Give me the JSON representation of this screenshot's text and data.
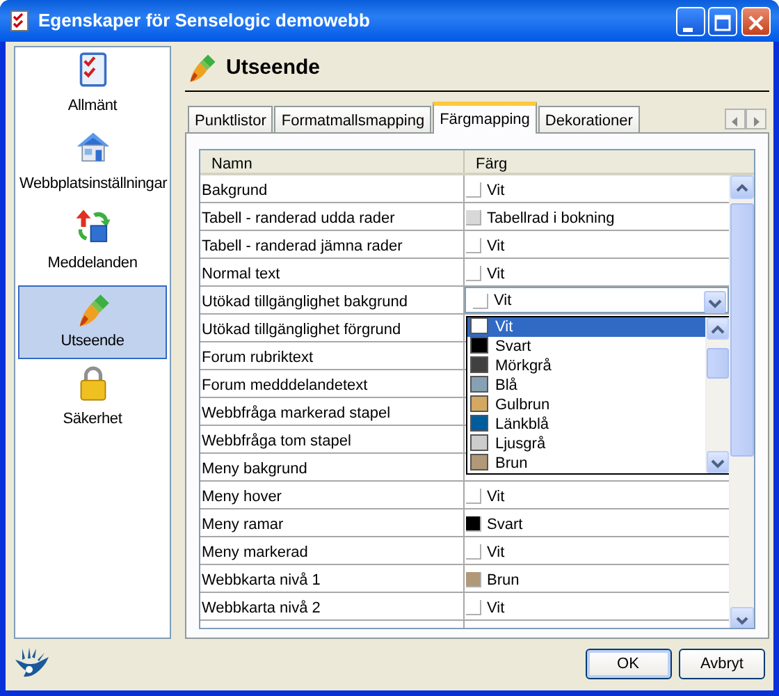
{
  "window": {
    "title": "Egenskaper för Senselogic demowebb"
  },
  "sidebar": {
    "items": [
      {
        "label": "Allmänt",
        "selected": false
      },
      {
        "label": "Webbplatsinställningar",
        "selected": false
      },
      {
        "label": "Meddelanden",
        "selected": false
      },
      {
        "label": "Utseende",
        "selected": true
      },
      {
        "label": "Säkerhet",
        "selected": false
      }
    ]
  },
  "page": {
    "title": "Utseende"
  },
  "tabs": [
    {
      "label": "Punktlistor",
      "selected": false
    },
    {
      "label": "Formatmallsmapping",
      "selected": false
    },
    {
      "label": "Färgmapping",
      "selected": true
    },
    {
      "label": "Dekorationer",
      "selected": false
    }
  ],
  "table": {
    "columns": [
      "Namn",
      "Färg"
    ],
    "rows": [
      {
        "name": "Bakgrund",
        "value": "Vit",
        "color": "#ffffff"
      },
      {
        "name": "Tabell - randerad udda rader",
        "value": "Tabellrad i bokning",
        "color": "#d8d8d8"
      },
      {
        "name": "Tabell - randerad jämna rader",
        "value": "Vit",
        "color": "#ffffff"
      },
      {
        "name": "Normal text",
        "value": "Vit",
        "color": "#ffffff"
      },
      {
        "name": "Utökad tillgänglighet bakgrund",
        "value": "Vit",
        "color": "#ffffff",
        "editing": true,
        "options": [
          {
            "label": "Vit",
            "color": "#ffffff",
            "selected": true
          },
          {
            "label": "Svart",
            "color": "#000000",
            "selected": false
          },
          {
            "label": "Mörkgrå",
            "color": "#404040",
            "selected": false
          },
          {
            "label": "Blå",
            "color": "#88a0b4",
            "selected": false
          },
          {
            "label": "Gulbrun",
            "color": "#d4a860",
            "selected": false
          },
          {
            "label": "Länkblå",
            "color": "#005c9c",
            "selected": false
          },
          {
            "label": "Ljusgrå",
            "color": "#cccccc",
            "selected": false
          },
          {
            "label": "Brun",
            "color": "#b09878",
            "selected": false
          }
        ]
      },
      {
        "name": "Utökad tillgänglighet förgrund"
      },
      {
        "name": "Forum rubriktext"
      },
      {
        "name": "Forum medddelandetext"
      },
      {
        "name": "Webbfråga markerad stapel"
      },
      {
        "name": "Webbfråga tom stapel"
      },
      {
        "name": "Meny bakgrund"
      },
      {
        "name": "Meny hover",
        "value": "Vit",
        "color": "#ffffff"
      },
      {
        "name": "Meny ramar",
        "value": "Svart",
        "color": "#000000"
      },
      {
        "name": "Meny markerad",
        "value": "Vit",
        "color": "#ffffff"
      },
      {
        "name": "Webbkarta nivå 1",
        "value": "Brun",
        "color": "#b09878"
      },
      {
        "name": "Webbkarta nivå 2",
        "value": "Vit",
        "color": "#ffffff"
      }
    ]
  },
  "buttons": [
    {
      "label": "OK",
      "default": true
    },
    {
      "label": "Avbryt",
      "default": false
    }
  ]
}
